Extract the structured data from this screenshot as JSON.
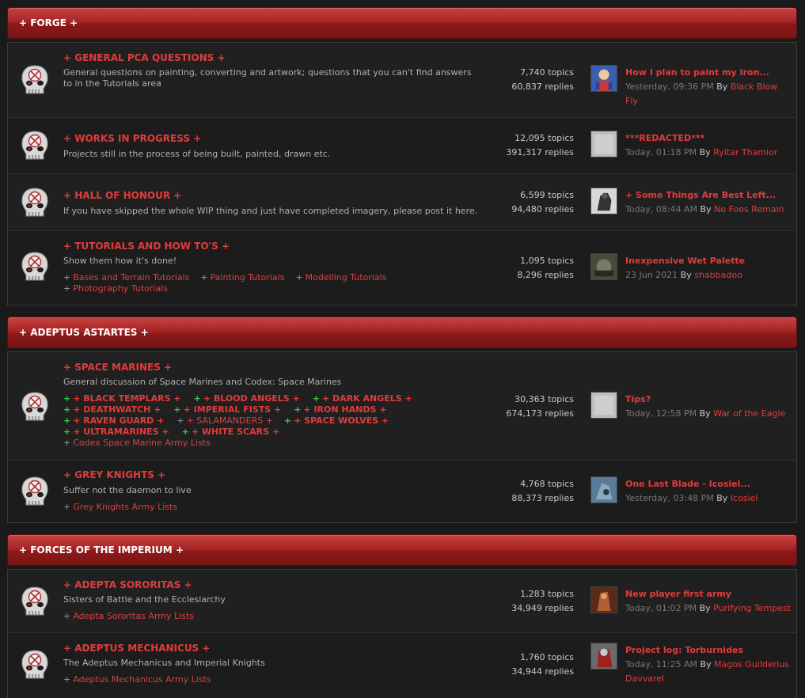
{
  "categories": [
    {
      "title": "+ FORGE +"
    },
    {
      "title": "+ ADEPTUS ASTARTES +"
    },
    {
      "title": "+ FORCES OF THE IMPERIUM +"
    }
  ],
  "forums": [
    {
      "name": "+ GENERAL PCA QUESTIONS +",
      "desc": "General questions on painting, converting and artwork; questions that you can't find answers to in the Tutorials area",
      "topics": "7,740 topics",
      "replies": "60,837 replies",
      "last_title": "How I plan to paint my Iron...",
      "last_time": "Yesterday, 09:36 PM",
      "last_user": "Black Blow Fly"
    },
    {
      "name": "+ WORKS IN PROGRESS +",
      "desc": "Projects still in the process of being built, painted, drawn etc.",
      "topics": "12,095 topics",
      "replies": "391,317 replies",
      "last_title": "***REDACTED***",
      "last_time": "Today, 01:18 PM",
      "last_user": "Ryltar Thamior"
    },
    {
      "name": "+ HALL OF HONOUR +",
      "desc": "If you have skipped the whole WIP thing and just have completed imagery, please post it here.",
      "topics": "6,599 topics",
      "replies": "94,480 replies",
      "last_title": "+ Some Things Are Best Left...",
      "last_time": "Today, 08:44 AM",
      "last_user": "No Foes Remain"
    },
    {
      "name": "+ TUTORIALS AND HOW TO'S +",
      "desc": "Show them how it's done!",
      "topics": "1,095 topics",
      "replies": "8,296 replies",
      "last_title": "Inexpensive Wet Palette",
      "last_time": "23 Jun 2021",
      "last_user": "shabbadoo",
      "subforums": [
        "Bases and Terrain Tutorials",
        "Painting Tutorials",
        "Modelling Tutorials",
        "Photography Tutorials"
      ]
    },
    {
      "name": "+ SPACE MARINES +",
      "desc": "General discussion of Space Marines and Codex: Space Marines",
      "topics": "30,363 topics",
      "replies": "674,173 replies",
      "last_title": "Tips?",
      "last_time": "Today, 12:58 PM",
      "last_user": "War of the Eagle",
      "subforums": [
        "+ BLACK TEMPLARS +",
        "+ BLOOD ANGELS +",
        "+ DARK ANGELS +",
        "+ DEATHWATCH +",
        "+ IMPERIAL FISTS +",
        "+ IRON HANDS +",
        "+ RAVEN GUARD +",
        "+ SALAMANDERS +",
        "+ SPACE WOLVES +",
        "+ ULTRAMARINES +",
        "+ WHITE SCARS +",
        "Codex Space Marine Army Lists"
      ]
    },
    {
      "name": "+ GREY KNIGHTS +",
      "desc": "Suffer not the daemon to live",
      "topics": "4,768 topics",
      "replies": "88,373 replies",
      "last_title": "One Last Blade - Icosiel...",
      "last_time": "Yesterday, 03:48 PM",
      "last_user": "Icosiel",
      "subforums": [
        "Grey Knights Army Lists"
      ]
    },
    {
      "name": "+ ADEPTA SORORITAS +",
      "desc": "Sisters of Battle and the Ecclesiarchy",
      "topics": "1,283 topics",
      "replies": "34,949 replies",
      "last_title": "New player first army",
      "last_time": "Today, 01:02 PM",
      "last_user": "Purifying Tempest",
      "subforums": [
        "Adepta Sororitas Army Lists"
      ]
    },
    {
      "name": "+ ADEPTUS MECHANICUS +",
      "desc": "The Adeptus Mechanicus and Imperial Knights",
      "topics": "1,760 topics",
      "replies": "34,944 replies",
      "last_title": "Project log: Torburnides",
      "last_time": "Today, 11:25 AM",
      "last_user": "Magos Guilderius Davvarel",
      "subforums": [
        "Adeptus Mechanicus Army Lists"
      ]
    }
  ],
  "labels": {
    "by": "By",
    "bullet": "+"
  },
  "colors": {
    "accent": "#e33b3b",
    "header": "#a82525",
    "bg": "#1a1a1a",
    "panel": "#202020",
    "green": "#3ecb3e"
  },
  "icons": {
    "forum": "skull-forum-icon"
  }
}
